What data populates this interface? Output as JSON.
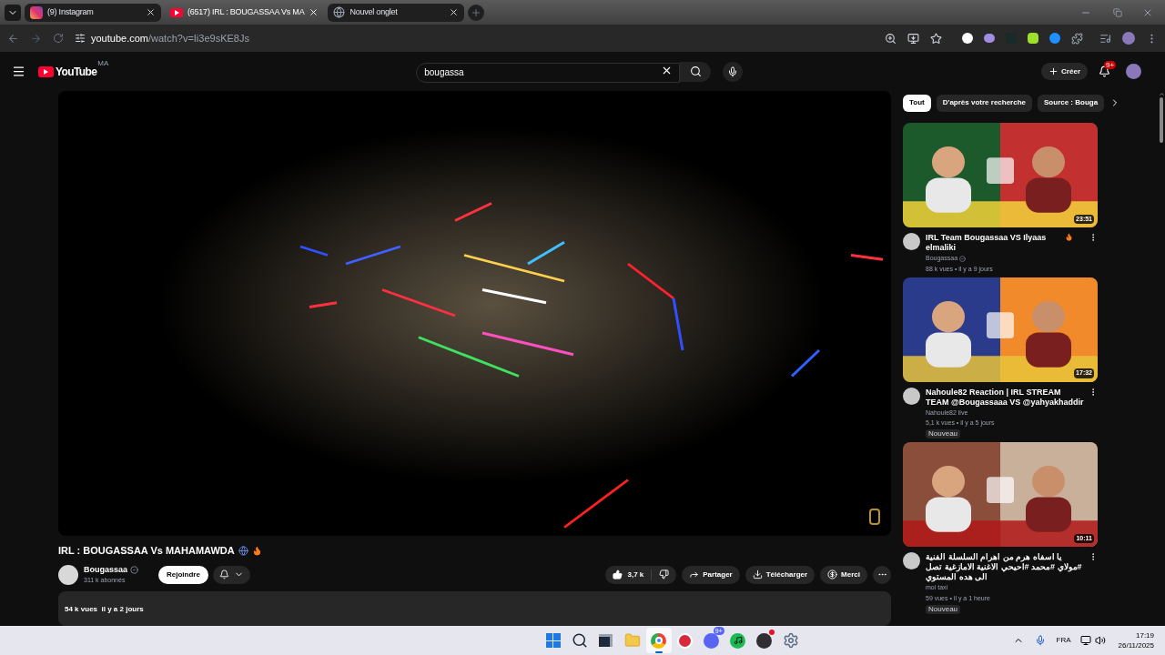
{
  "browser": {
    "tabs": [
      {
        "kind": "instagram",
        "title": "(9) Instagram",
        "selected": false
      },
      {
        "kind": "youtube",
        "title": "(6517) IRL : BOUGASSAA Vs MA",
        "selected": true
      },
      {
        "kind": "newtab",
        "title": "Nouvel onglet",
        "selected": false
      }
    ],
    "url": {
      "host": "youtube.com",
      "path": "/watch?v=Ii3e9sKE8Js"
    }
  },
  "youtube": {
    "logo_text": "YouTube",
    "region": "MA",
    "search": {
      "value": "bougassa"
    },
    "create_label": "Créer",
    "notifications_badge": "9+"
  },
  "video": {
    "title": "IRL : BOUGASSAA Vs MAHAMAWDA",
    "channel": {
      "name": "Bougassaa",
      "verified": true,
      "subscribers": "311 k abonnés"
    },
    "join_label": "Rejoindre",
    "likes": "3,7 k",
    "actions": [
      {
        "kind": "share",
        "label": "Partager"
      },
      {
        "kind": "download",
        "label": "Télécharger"
      },
      {
        "kind": "thanks",
        "label": "Merci"
      }
    ],
    "description_meta": "54 k vues  il y a 2 jours"
  },
  "chips": [
    {
      "label": "Tout",
      "selected": true
    },
    {
      "label": "D'après votre recherche",
      "selected": false
    },
    {
      "label": "Source : Bouga",
      "selected": false
    }
  ],
  "recommendations": [
    {
      "title": "IRL Team Bougassaa VS Ilyaas elmaliki",
      "fire": true,
      "channel": "Bougassaa",
      "verified": true,
      "meta": "88 k vues • il y a 9 jours",
      "duration": "23:51"
    },
    {
      "title": "Nahoule82 Reaction | IRL STREAM TEAM @Bougassaaa VS @yahyakhaddir",
      "fire": false,
      "channel": "Nahoule82 live",
      "verified": false,
      "meta": "5,1 k vues • il y a 5 jours",
      "duration": "17:32",
      "badge": "Nouveau"
    },
    {
      "title": "يا اسفاه هرم من اهرام السلسلة الفنية #مولاي #محمد #احيحي الاغنية الامازغية تصل الى هده المستوي",
      "fire": false,
      "channel": "moi taxi",
      "verified": false,
      "meta": "59 vues • il y a 1 heure",
      "duration": "10:11",
      "badge": "Nouveau"
    }
  ],
  "taskbar": {
    "apps": [
      {
        "kind": "start",
        "active": false
      },
      {
        "kind": "search",
        "active": false
      },
      {
        "kind": "taskview",
        "active": false
      },
      {
        "kind": "files",
        "active": false
      },
      {
        "kind": "chrome",
        "active": true
      },
      {
        "kind": "app",
        "active": false
      },
      {
        "kind": "discord",
        "active": false,
        "badge": "9+"
      },
      {
        "kind": "spotify",
        "active": false
      },
      {
        "kind": "obs",
        "active": false,
        "dot": true
      },
      {
        "kind": "settings",
        "active": false
      }
    ],
    "tray": {
      "language": "FRA",
      "time": "17:19",
      "date": "26/11/2025"
    }
  }
}
